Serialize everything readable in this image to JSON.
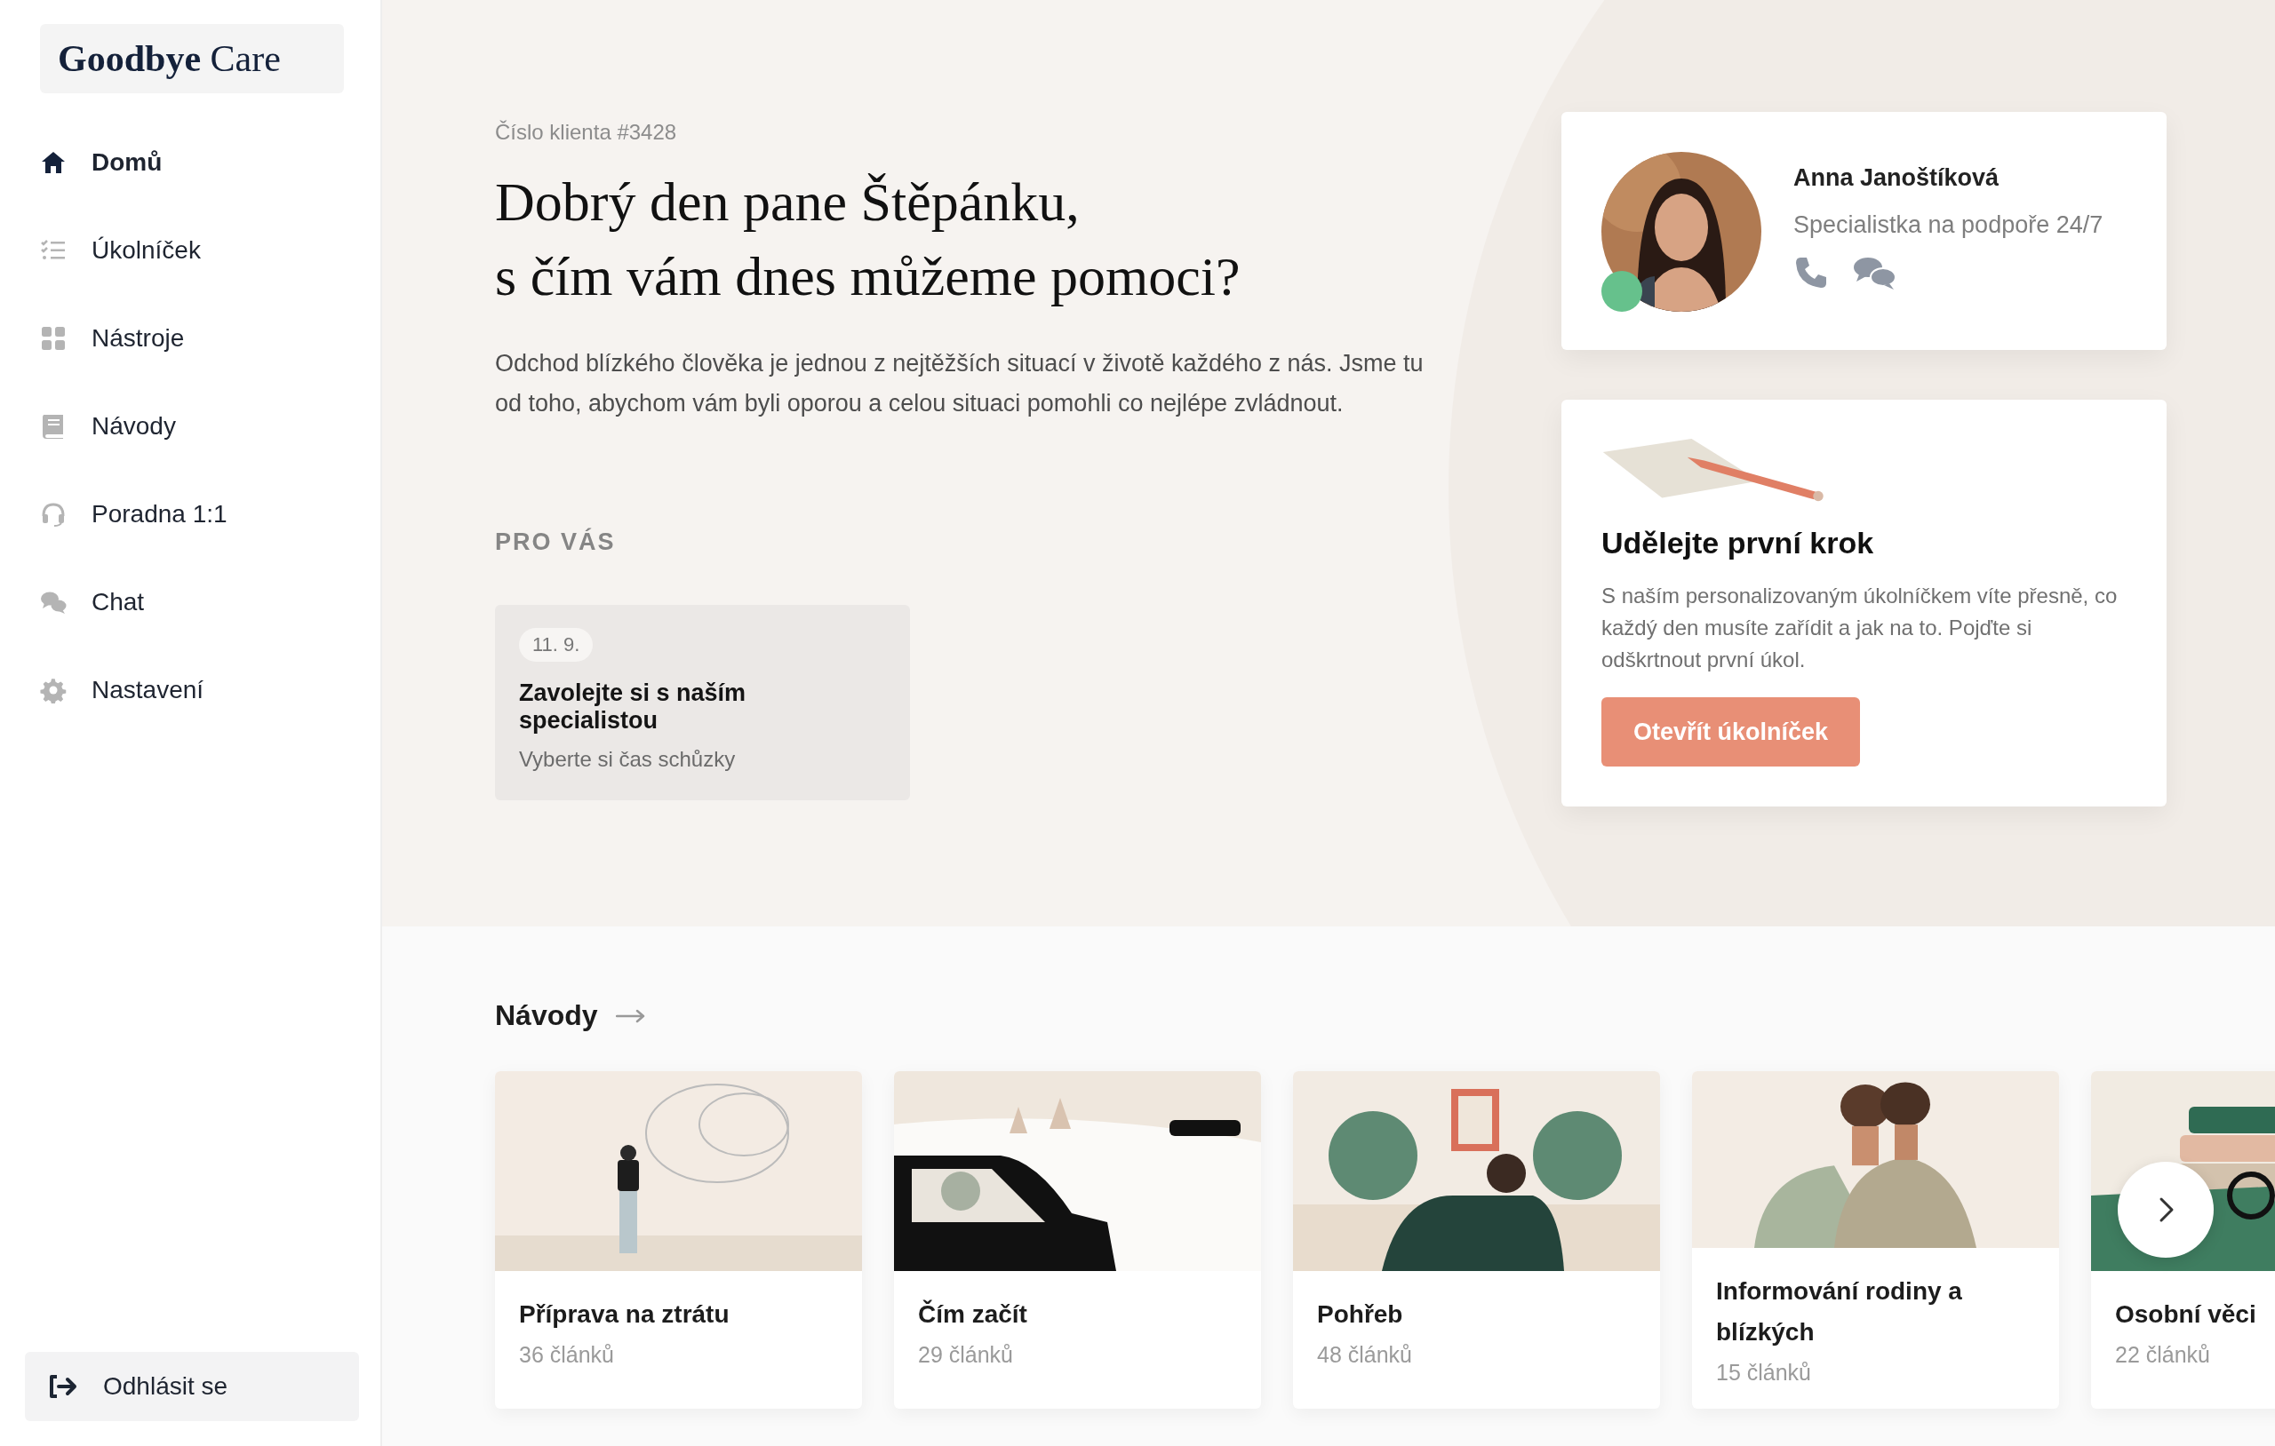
{
  "brand": {
    "logo": "**Goodbye** Care"
  },
  "nav": [
    {
      "label": "Domů",
      "kind": "home",
      "selected": true
    },
    {
      "label": "Úkolníček",
      "kind": "tasks",
      "selected": false
    },
    {
      "label": "Nástroje",
      "kind": "tools",
      "selected": false
    },
    {
      "label": "Návody",
      "kind": "book",
      "selected": false
    },
    {
      "label": "Poradna 1:1",
      "kind": "headset",
      "selected": false
    },
    {
      "label": "Chat",
      "kind": "chat",
      "selected": false
    },
    {
      "label": "Nastavení",
      "kind": "settings",
      "selected": false
    }
  ],
  "logout": {
    "label": "Odhlásit se"
  },
  "client_number": "Číslo klienta #3428",
  "greeting": [
    "Dobrý den pane Štěpánku,",
    "s čím vám dnes můžeme pomoci?"
  ],
  "intro": "Odchod blízkého člověka je jednou z nejtěžších situací v životě každého z nás. Jsme tu od toho, abychom vám byli oporou a celou situaci pomohli co nejlépe zvládnout.",
  "for_you": {
    "heading": "PRO VÁS",
    "items": [
      {
        "date": "11. 9.",
        "title": "Zavolejte si s naším specialistou",
        "subtitle": "Vyberte si čas schůzky"
      }
    ]
  },
  "specialist": {
    "name": "Anna Janoštíková",
    "role": "Specialistka na podpoře 24/7",
    "online": true
  },
  "first_step": {
    "title": "Udělejte první krok",
    "text": "S naším personalizovaným úkolníčkem víte přesně, co každý den musíte zařídit a jak na to. Pojďte si odškrtnout první úkol.",
    "button": "Otevřít úkolníček"
  },
  "guides": {
    "heading": "Návody",
    "cards": [
      {
        "title": "Příprava na ztrátu",
        "count": "36 článků"
      },
      {
        "title": "Čím začít",
        "count": "29 článků"
      },
      {
        "title": "Pohřeb",
        "count": "48 článků"
      },
      {
        "title": "Informování rodiny a blízkých",
        "count": "15 článků"
      },
      {
        "title": "Osobní věci",
        "count": "22 článků"
      }
    ]
  }
}
